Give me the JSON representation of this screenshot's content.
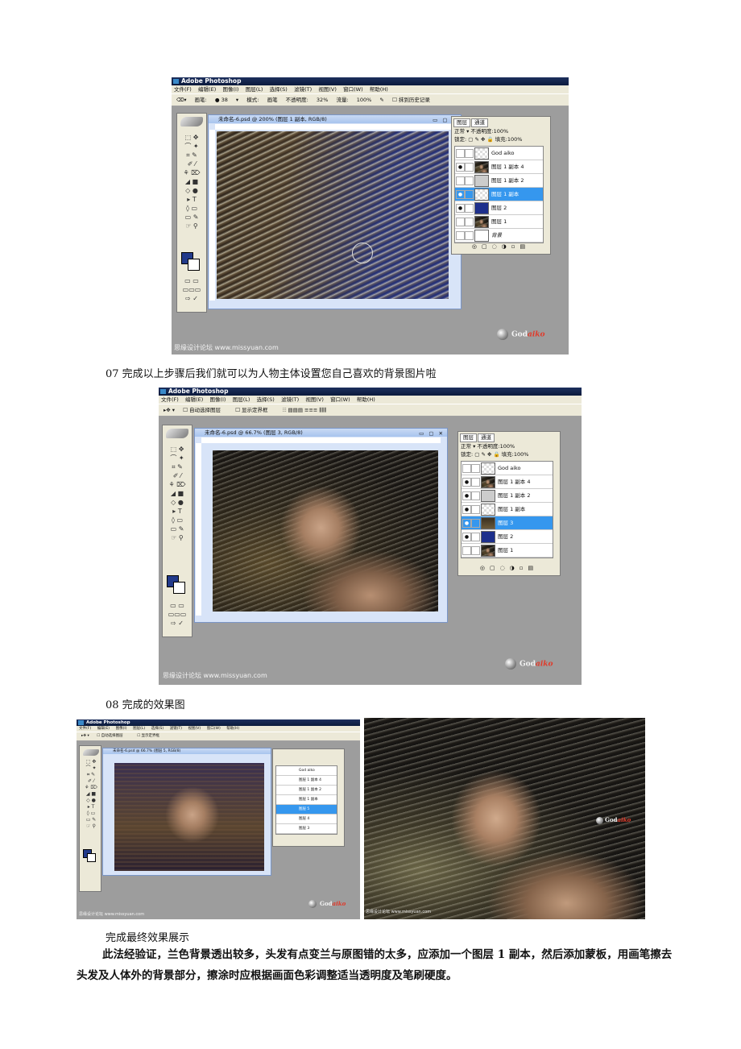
{
  "ps_window": {
    "app_title": "Adobe Photoshop",
    "menu": [
      "文件(F)",
      "编辑(E)",
      "图像(I)",
      "图层(L)",
      "选择(S)",
      "滤镜(T)",
      "视图(V)",
      "窗口(W)",
      "帮助(H)"
    ]
  },
  "shot1": {
    "options": {
      "brush_label": "画笔:",
      "brush_size": "38",
      "mode_label": "模式:",
      "mode_value": "画笔",
      "opacity_label": "不透明度:",
      "opacity_value": "32%",
      "flow_label": "流量:",
      "flow_value": "100%",
      "history_label": "抹到历史记录"
    },
    "doc_title": "未命名-6.psd @ 200% (图层 1 副本, RGB/8)",
    "layers_panel": {
      "tabs": [
        "图层",
        "通道"
      ],
      "blend_mode": "正常",
      "opacity_label": "不透明度:",
      "opacity_value": "100%",
      "lock_label": "锁定:",
      "fill_label": "填充:",
      "fill_value": "100%",
      "layers": [
        "God aiko",
        "图层 1 副本 4",
        "图层 1 副本 2",
        "图层 1 副本",
        "图层 2",
        "图层 1",
        "背景"
      ]
    },
    "watermark": "思缘设计论坛 www.missyuan.com"
  },
  "caption07": "07 完成以上步骤后我们就可以为人物主体设置您自己喜欢的背景图片啦",
  "shot2": {
    "options": {
      "auto_select": "自动选择图层",
      "show_bounds": "显示定界框"
    },
    "doc_title": "未命名-6.psd @ 66.7% (图层 3, RGB/8)",
    "layers_panel": {
      "tabs": [
        "图层",
        "通道"
      ],
      "blend_mode": "正常",
      "opacity_label": "不透明度:",
      "opacity_value": "100%",
      "lock_label": "锁定:",
      "fill_label": "填充:",
      "fill_value": "100%",
      "layers": [
        "God aiko",
        "图层 1 副本 4",
        "图层 1 副本 2",
        "图层 1 副本",
        "图层 3",
        "图层 2",
        "图层 1"
      ]
    },
    "watermark": "思缘设计论坛 www.missyuan.com"
  },
  "caption08": "08 完成的效果图",
  "shot3": {
    "doc_title": "未命名-6.psd @ 66.7% (图层 5, RGB/8)",
    "layers": [
      "God aiko",
      "图层 1 副本 4",
      "图层 1 副本 2",
      "图层 1 副本",
      "图层 5",
      "图层 4",
      "图层 3"
    ]
  },
  "logo": {
    "main": "God",
    "sub": "aiko"
  },
  "caption_final": "完成最终效果展示",
  "note_paragraph": "此法经验证，兰色背景透出较多，头发有点变兰与原图错的太多，应添加一个图层 1 副本，然后添加蒙板，用画笔擦去头发及人体外的背景部分，擦涂时应根据画面色彩调整适当透明度及笔刷硬度。",
  "colors": {
    "selected_layer": "#3597ee",
    "foreground_swatch": "#223a8a",
    "canvas_blue": "#1a2c90"
  }
}
